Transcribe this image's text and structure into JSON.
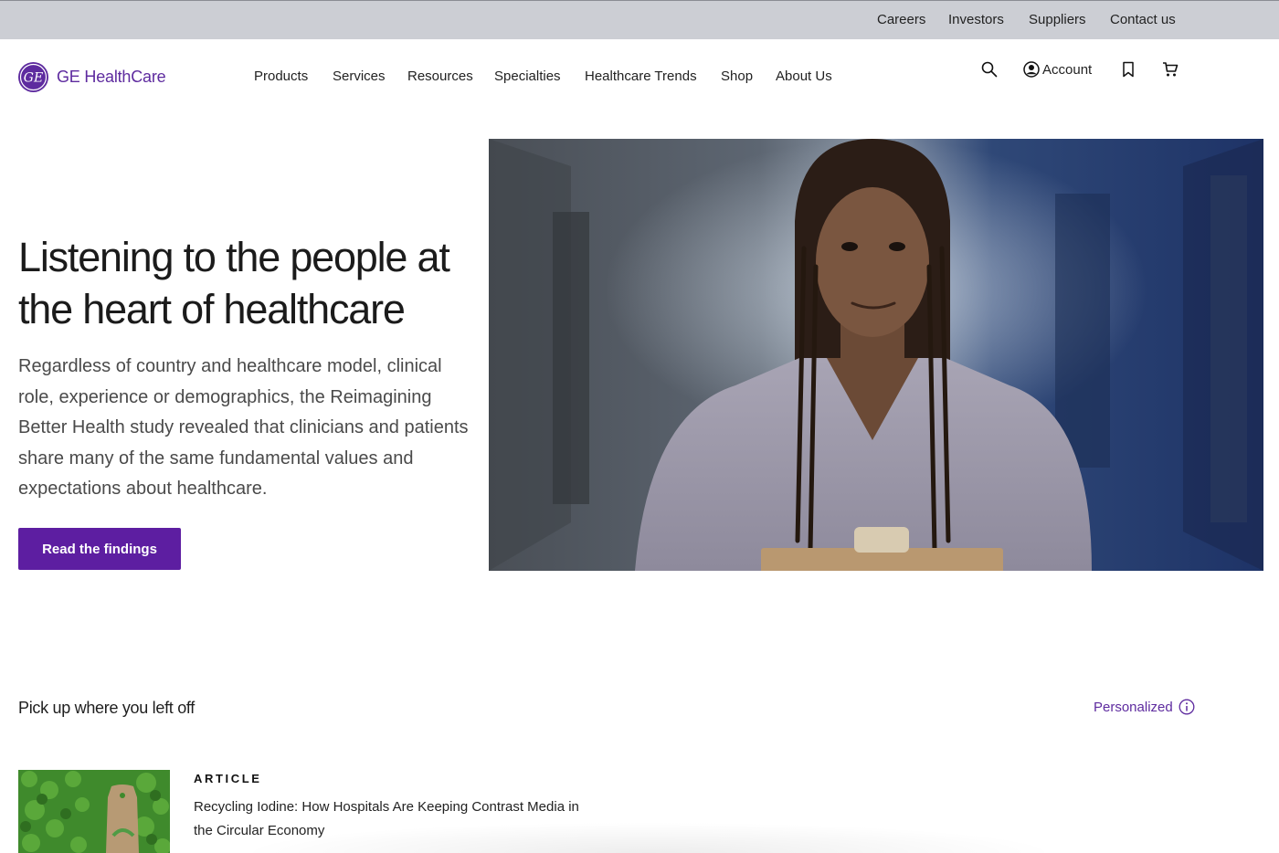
{
  "utility_nav": {
    "links": [
      "Careers",
      "Investors",
      "Suppliers",
      "Contact us"
    ]
  },
  "brand": {
    "name": "GE HealthCare",
    "mark": "GE",
    "color": "#5e2b9f"
  },
  "main_nav": {
    "items": [
      "Products",
      "Services",
      "Resources",
      "Specialties",
      "Healthcare Trends",
      "Shop",
      "About Us"
    ],
    "account_label": "Account",
    "icons": [
      "search-icon",
      "account-icon",
      "bookmark-icon",
      "cart-icon"
    ]
  },
  "hero": {
    "title": "Listening to the people at the heart of healthcare",
    "body": "Regardless of country and healthcare model, clinical role, experience or demographics, the Reimagining Better Health study revealed that clinicians and patients share many of the same fundamental values and expectations about healthcare.",
    "cta_label": "Read the findings",
    "cta_color": "#5d1ea1"
  },
  "continue_section": {
    "title": "Pick up where you left off",
    "personalized_label": "Personalized",
    "card": {
      "type": "ARTICLE",
      "title": "Recycling Iodine: How Hospitals Are Keeping Contrast Media in the Circular Economy"
    }
  }
}
